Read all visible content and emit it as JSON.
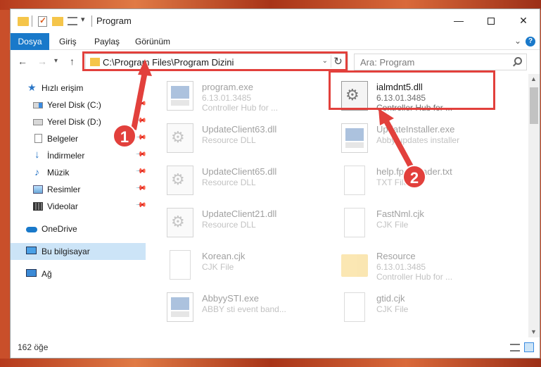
{
  "window": {
    "title": "Program"
  },
  "ribbon": {
    "tabs": [
      "Dosya",
      "Giriş",
      "Paylaş",
      "Görünüm"
    ]
  },
  "navigation": {
    "address": "C:\\Program Files\\Program Dizini",
    "search_placeholder": "Ara: Program"
  },
  "sidebar": {
    "items": [
      {
        "label": "Hızlı erişim",
        "icon": "star-icon"
      },
      {
        "label": "Yerel Disk (C:)",
        "icon": "drive-icon"
      },
      {
        "label": "Yerel Disk (D:)",
        "icon": "drive-icon"
      },
      {
        "label": "Belgeler",
        "icon": "documents-icon"
      },
      {
        "label": "İndirmeler",
        "icon": "downloads-icon"
      },
      {
        "label": "Müzik",
        "icon": "music-icon"
      },
      {
        "label": "Resimler",
        "icon": "pictures-icon"
      },
      {
        "label": "Videolar",
        "icon": "videos-icon"
      },
      {
        "label": "OneDrive",
        "icon": "cloud-icon"
      },
      {
        "label": "Bu bilgisayar",
        "icon": "computer-icon",
        "selected": true
      },
      {
        "label": "Ağ",
        "icon": "network-icon"
      }
    ]
  },
  "files": [
    {
      "name": "program.exe",
      "line2": "6.13.01.3485",
      "line3": "Controller Hub for ...",
      "type": "exe"
    },
    {
      "name": "ialmdnt5.dll",
      "line2": "6.13.01.3485",
      "line3": "Controller Hub for ...",
      "type": "dll",
      "highlighted": true
    },
    {
      "name": "UpdateClient63.dll",
      "line2": "Resource DLL",
      "line3": "",
      "type": "dll"
    },
    {
      "name": "UpdateInstaller.exe",
      "line2": "Abby updates installer",
      "line3": "",
      "type": "exe"
    },
    {
      "name": "UpdateClient65.dll",
      "line2": "Resource DLL",
      "line3": "",
      "type": "dll"
    },
    {
      "name": "help.fpdf.reader.txt",
      "line2": "TXT File",
      "line3": "",
      "type": "txt"
    },
    {
      "name": "UpdateClient21.dll",
      "line2": "Resource DLL",
      "line3": "",
      "type": "dll"
    },
    {
      "name": "FastNml.cjk",
      "line2": "CJK File",
      "line3": "",
      "type": "cjk"
    },
    {
      "name": "Korean.cjk",
      "line2": "CJK File",
      "line3": "",
      "type": "cjk"
    },
    {
      "name": "Resource",
      "line2": "6.13.01.3485",
      "line3": "Controller Hub for ...",
      "type": "folder"
    },
    {
      "name": "AbbyySTI.exe",
      "line2": "ABBY sti event band...",
      "line3": "",
      "type": "exe"
    },
    {
      "name": "gtid.cjk",
      "line2": "CJK File",
      "line3": "",
      "type": "cjk"
    }
  ],
  "callouts": [
    "1",
    "2"
  ],
  "status": {
    "item_count": "162 öğe"
  },
  "colors": {
    "accent": "#1979ca",
    "highlight": "#e2403c",
    "selected_bg": "#cce4f7"
  }
}
